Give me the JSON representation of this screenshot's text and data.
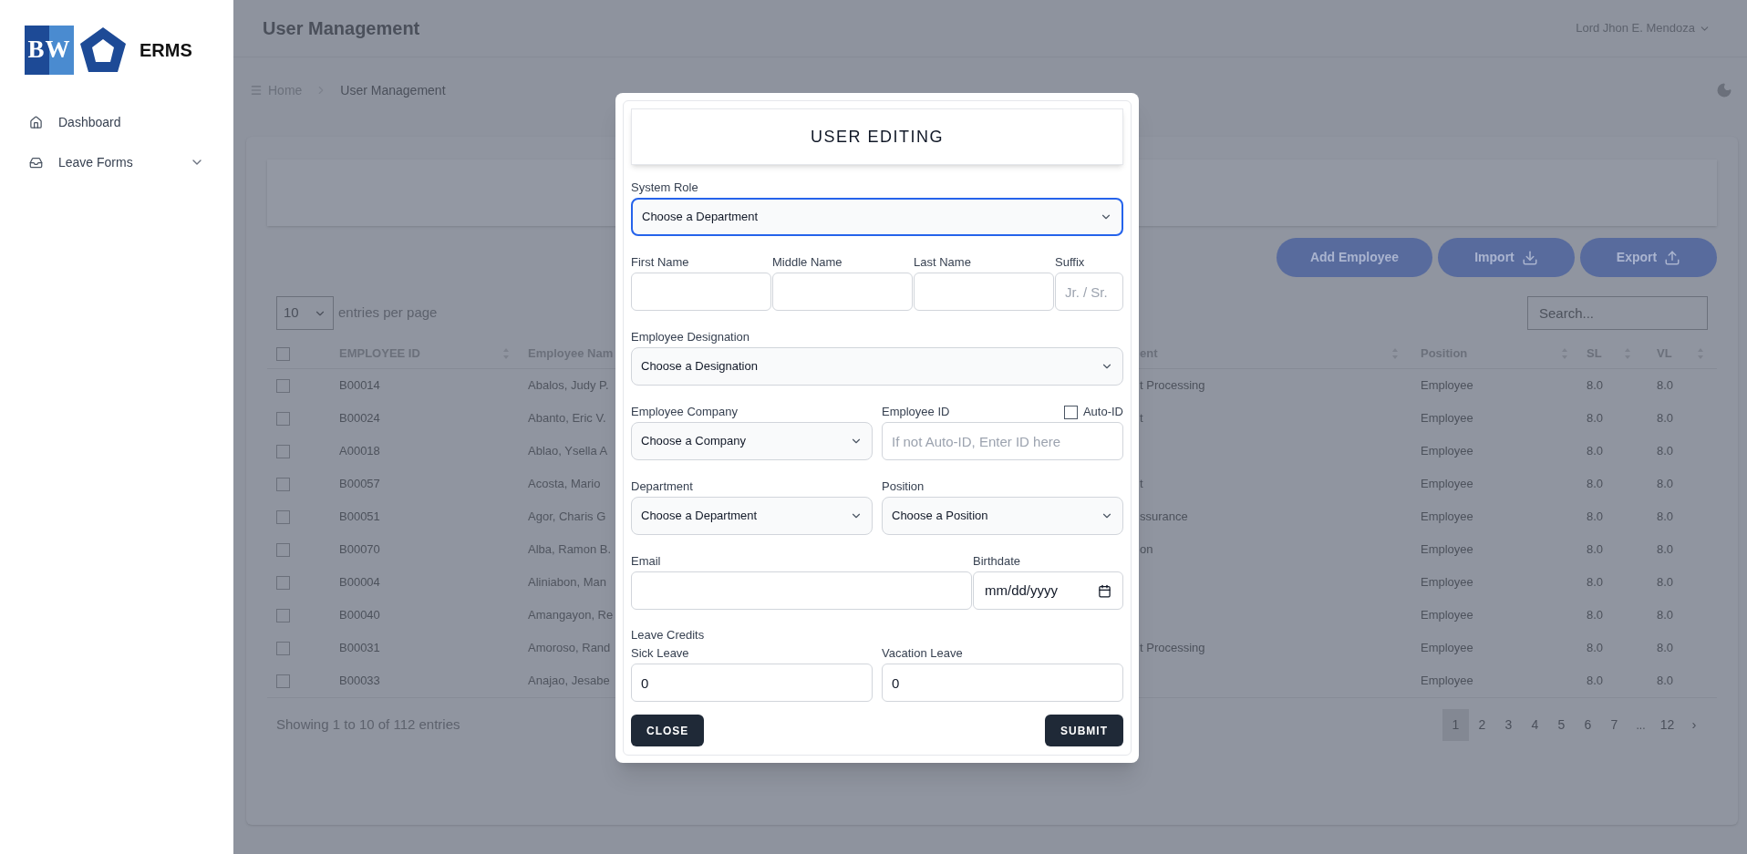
{
  "sidebar": {
    "logo_text": "BW",
    "app_name": "ERMS",
    "items": [
      {
        "label": "Dashboard",
        "kind": "link"
      },
      {
        "label": "Leave Forms",
        "kind": "group"
      }
    ]
  },
  "header": {
    "title": "User Management",
    "user": "Lord Jhon E. Mendoza"
  },
  "breadcrumb": [
    "Home",
    "User Management"
  ],
  "actions": [
    {
      "label": "Add Employee",
      "kind": "plain"
    },
    {
      "label": "Import",
      "kind": "download"
    },
    {
      "label": "Export",
      "kind": "upload"
    }
  ],
  "entries": {
    "value": "10",
    "label": "entries per page"
  },
  "search": {
    "placeholder": "Search..."
  },
  "table": {
    "columns": [
      "EMPLOYEE ID",
      "Employee Nam",
      "ent",
      "Position",
      "SL",
      "VL"
    ],
    "header_checked": false,
    "rows": [
      {
        "checked": false,
        "cells": [
          "B00014",
          "Abalos, Judy P.",
          "t Processing",
          "Employee",
          "8.0",
          "8.0"
        ]
      },
      {
        "checked": false,
        "cells": [
          "B00024",
          "Abanto, Eric V.",
          "t",
          "Employee",
          "8.0",
          "8.0"
        ]
      },
      {
        "checked": false,
        "cells": [
          "A00018",
          "Ablao, Ysella A",
          "",
          "Employee",
          "8.0",
          "8.0"
        ]
      },
      {
        "checked": false,
        "cells": [
          "B00057",
          "Acosta, Mario",
          "t",
          "Employee",
          "8.0",
          "8.0"
        ]
      },
      {
        "checked": false,
        "cells": [
          "B00051",
          "Agor, Charis G",
          "ssurance",
          "Employee",
          "8.0",
          "8.0"
        ]
      },
      {
        "checked": false,
        "cells": [
          "B00070",
          "Alba, Ramon B.",
          "on",
          "Employee",
          "8.0",
          "8.0"
        ]
      },
      {
        "checked": false,
        "cells": [
          "B00004",
          "Aliniabon, Man",
          "",
          "Employee",
          "8.0",
          "8.0"
        ]
      },
      {
        "checked": false,
        "cells": [
          "B00040",
          "Amangayon, Re",
          "",
          "Employee",
          "8.0",
          "8.0"
        ]
      },
      {
        "checked": false,
        "cells": [
          "B00031",
          "Amoroso, Rand",
          "t Processing",
          "Employee",
          "8.0",
          "8.0"
        ]
      },
      {
        "checked": false,
        "cells": [
          "B00033",
          "Anajao, Jesabe",
          "",
          "Employee",
          "8.0",
          "8.0"
        ]
      }
    ]
  },
  "footer": {
    "summary": "Showing 1 to 10 of 112 entries",
    "pages": [
      {
        "label": "1",
        "kind": "page",
        "selected": true
      },
      {
        "label": "2",
        "kind": "page",
        "selected": false
      },
      {
        "label": "3",
        "kind": "page",
        "selected": false
      },
      {
        "label": "4",
        "kind": "page",
        "selected": false
      },
      {
        "label": "5",
        "kind": "page",
        "selected": false
      },
      {
        "label": "6",
        "kind": "page",
        "selected": false
      },
      {
        "label": "7",
        "kind": "page",
        "selected": false
      },
      {
        "label": "...",
        "kind": "ellipsis",
        "selected": false
      },
      {
        "label": "12",
        "kind": "page",
        "selected": false
      }
    ],
    "next": "›"
  },
  "modal": {
    "title": "USER EDITING",
    "system_role": {
      "label": "System Role",
      "value": "Choose a Department",
      "focused": true
    },
    "first_name": {
      "label": "First Name"
    },
    "middle_name": {
      "label": "Middle Name"
    },
    "last_name": {
      "label": "Last Name"
    },
    "suffix": {
      "label": "Suffix",
      "placeholder": "Jr. / Sr."
    },
    "designation": {
      "label": "Employee Designation",
      "value": "Choose a Designation",
      "focused": false
    },
    "company": {
      "label": "Employee Company",
      "value": "Choose a Company",
      "focused": false
    },
    "employee_id": {
      "label": "Employee ID",
      "placeholder": "If not Auto-ID, Enter ID here"
    },
    "auto_id": {
      "label": "Auto-ID",
      "checked": false
    },
    "department": {
      "label": "Department",
      "value": "Choose a Department",
      "focused": false
    },
    "position": {
      "label": "Position",
      "value": "Choose a Position",
      "focused": false
    },
    "email": {
      "label": "Email"
    },
    "birthdate": {
      "label": "Birthdate",
      "placeholder": "mm/dd/yyyy"
    },
    "leave_credits": {
      "title": "Leave Credits",
      "sick": {
        "label": "Sick Leave",
        "value": "0"
      },
      "vacation": {
        "label": "Vacation Leave",
        "value": "0"
      }
    },
    "close": "CLOSE",
    "submit": "SUBMIT"
  }
}
